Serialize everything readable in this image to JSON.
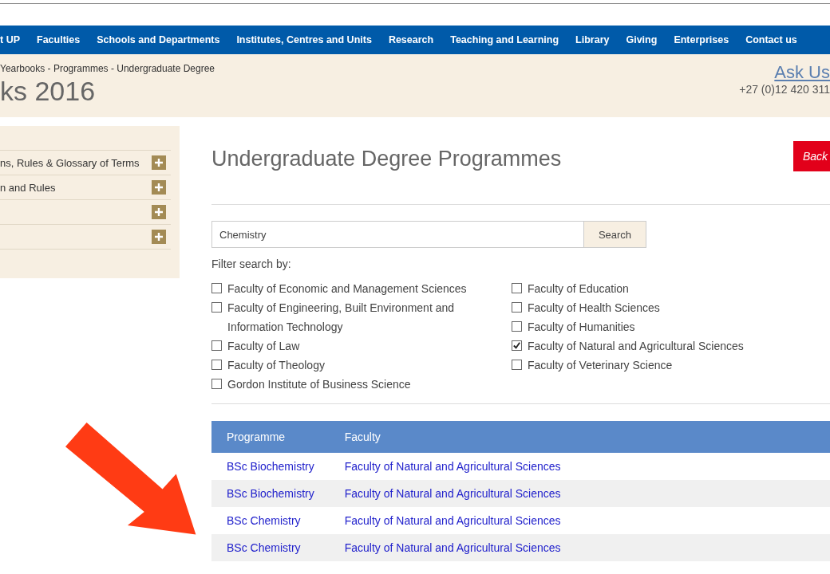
{
  "nav": [
    "t UP",
    "Faculties",
    "Schools and Departments",
    "Institutes, Centres and Units",
    "Research",
    "Teaching and Learning",
    "Library",
    "Giving",
    "Enterprises",
    "Contact us"
  ],
  "header": {
    "breadcrumb": "Yearbooks - Programmes - Undergraduate Degree",
    "title": "ks 2016",
    "ask_us": "Ask Us",
    "phone": "+27 (0)12 420 311"
  },
  "sidebar": {
    "items": [
      {
        "label": "ns, Rules & Glossary of Terms",
        "expanded": false
      },
      {
        "label": "n and Rules",
        "expanded": false
      },
      {
        "expanded": false
      },
      {
        "expanded": false
      }
    ]
  },
  "heading": "Undergraduate Degree Programmes",
  "back_button": "Back",
  "search": {
    "value": "Chemistry",
    "button": "Search"
  },
  "filter_label": "Filter search by:",
  "filters": [
    [
      {
        "label": "Faculty of Economic and Management Sciences",
        "checked": false
      },
      {
        "label": "Faculty of Engineering, Built Environment and Information Technology",
        "checked": false
      },
      {
        "label": "Faculty of Law",
        "checked": false
      },
      {
        "label": "Faculty of Theology",
        "checked": false
      },
      {
        "label": "Gordon Institute of Business Science",
        "checked": false
      }
    ],
    [
      {
        "label": "Faculty of Education",
        "checked": false
      },
      {
        "label": "Faculty of Health Sciences",
        "checked": false
      },
      {
        "label": "Faculty of Humanities",
        "checked": false
      },
      {
        "label": "Faculty of Natural and Agricultural Sciences",
        "checked": true
      },
      {
        "label": "Faculty of Veterinary Science",
        "checked": false
      }
    ]
  ],
  "table": {
    "columns": [
      "Programme",
      "Faculty"
    ],
    "rows": [
      [
        "BSc Biochemistry",
        "Faculty of Natural and Agricultural Sciences"
      ],
      [
        "BSc Biochemistry",
        "Faculty of Natural and Agricultural Sciences"
      ],
      [
        "BSc Chemistry",
        "Faculty of Natural and Agricultural Sciences"
      ],
      [
        "BSc Chemistry",
        "Faculty of Natural and Agricultural Sciences"
      ]
    ]
  }
}
